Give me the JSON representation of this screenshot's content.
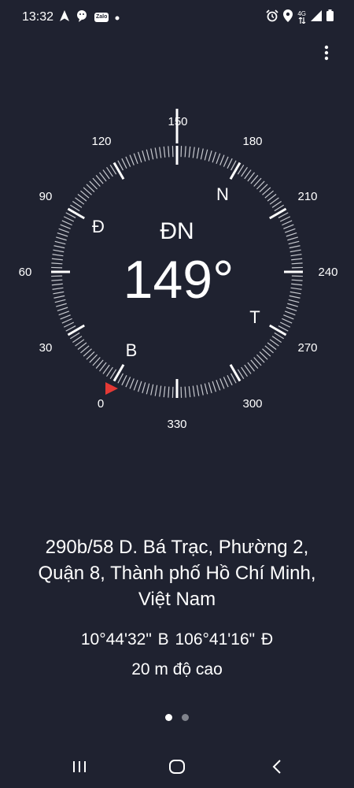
{
  "status_bar": {
    "time": "13:32",
    "left_icons": [
      "navigation-arrow-icon",
      "chat-bubble-icon",
      "zalo-app-icon",
      "dot-icon"
    ],
    "zalo_label": "Zalo",
    "network_label": "4G",
    "right_icons": [
      "alarm-icon",
      "location-icon",
      "network-4g-icon",
      "signal-icon",
      "battery-icon"
    ]
  },
  "menu": {
    "icon": "more-vertical-icon"
  },
  "compass": {
    "heading_direction": "ĐN",
    "heading_degrees": "149°",
    "top_marker_label": "150",
    "degree_labels": [
      "120",
      "180",
      "90",
      "210",
      "60",
      "240",
      "30",
      "270",
      "0",
      "300",
      "330"
    ],
    "cardinals": {
      "north": "N",
      "east": "Đ",
      "south": "T",
      "west": "B"
    },
    "accent_color": "#e53935",
    "heading_value": 149
  },
  "location": {
    "address_lines": [
      "290b/58 D. Bá Trạc, Phường 2,",
      "Quận 8, Thành phố Hồ Chí Minh,",
      "Việt Nam"
    ],
    "coordinates": "10°44'32\" B  106°41'16\" Đ",
    "altitude": "20 m độ cao"
  },
  "pagination": {
    "active_color": "#ffffff",
    "inactive_color": "#80838c"
  },
  "nav_bar": {
    "recents_icon": "recents-icon",
    "home_icon": "home-icon",
    "back_icon": "back-icon"
  }
}
